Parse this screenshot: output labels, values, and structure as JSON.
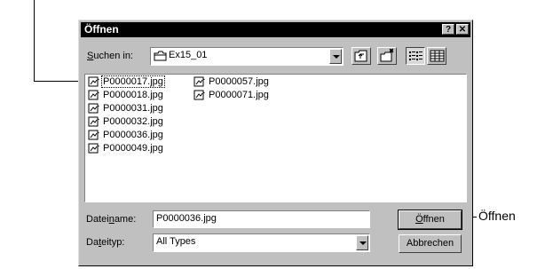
{
  "dialog": {
    "title": "Öffnen",
    "help_label": "?",
    "close_label": "✕",
    "look_in_label_prefix": "S",
    "look_in_label_rest": "uchen in:",
    "look_in_value": "Ex15_01",
    "filename_label_pre": "Datei",
    "filename_label_u": "n",
    "filename_label_post": "ame:",
    "filename_value": "P0000036.jpg",
    "filetype_label_pre": "Da",
    "filetype_label_u": "t",
    "filetype_label_post": "eityp:",
    "filetype_value": "All Types",
    "open_button_u": "Ö",
    "open_button_rest": "ffnen",
    "cancel_button": "Abbrechen"
  },
  "files": [
    {
      "name": "P0000017.jpg",
      "selected": true
    },
    {
      "name": "P0000018.jpg"
    },
    {
      "name": "P0000031.jpg"
    },
    {
      "name": "P0000032.jpg"
    },
    {
      "name": "P0000036.jpg"
    },
    {
      "name": "P0000049.jpg"
    },
    {
      "name": "P0000057.jpg"
    },
    {
      "name": "P0000071.jpg"
    }
  ],
  "callouts": {
    "open_label": "Öffnen"
  }
}
